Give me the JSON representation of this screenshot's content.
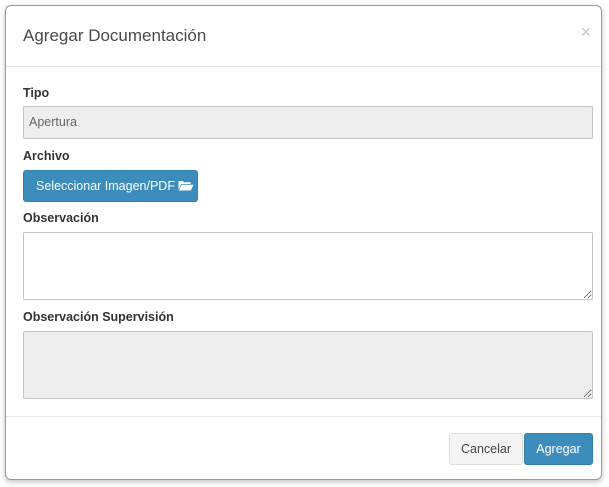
{
  "dialog": {
    "title": "Agregar Documentación",
    "close_symbol": "×"
  },
  "form": {
    "tipo": {
      "label": "Tipo",
      "value": "Apertura"
    },
    "archivo": {
      "label": "Archivo",
      "button_label": "Seleccionar Imagen/PDF",
      "icon": "folder-open-icon"
    },
    "observacion": {
      "label": "Observación",
      "value": ""
    },
    "observacion_supervision": {
      "label": "Observación Supervisión",
      "value": ""
    }
  },
  "footer": {
    "cancel_label": "Cancelar",
    "add_label": "Agregar"
  },
  "colors": {
    "primary": "#3c8dbc",
    "readonly_bg": "#eeeeee"
  }
}
